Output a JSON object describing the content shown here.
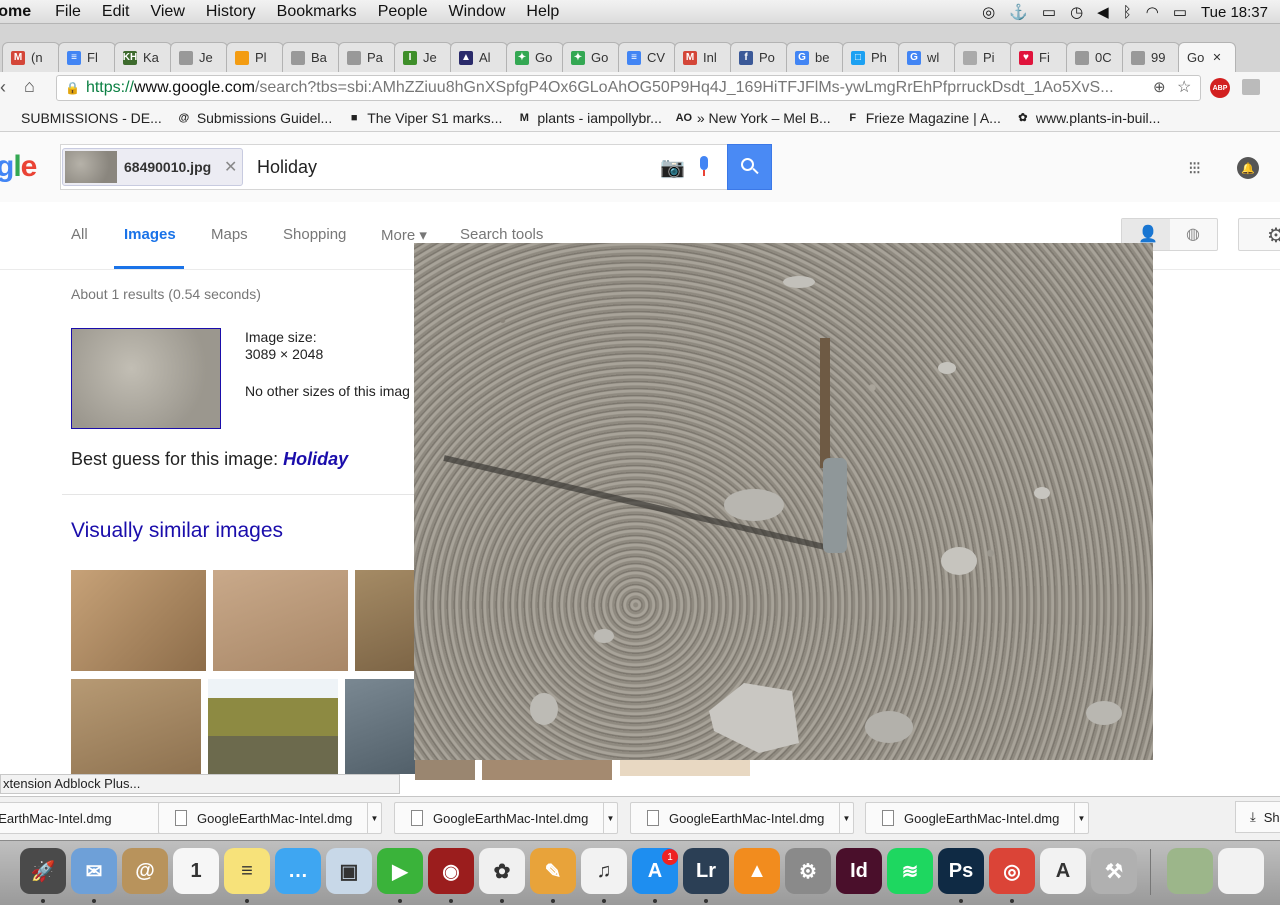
{
  "menubar": {
    "app": "rome",
    "items": [
      "File",
      "Edit",
      "View",
      "History",
      "Bookmarks",
      "People",
      "Window",
      "Help"
    ],
    "clock": "Tue 18:37"
  },
  "tabs": [
    {
      "label": "(n",
      "icon": "gmail-icon",
      "color": "#d44638",
      "glyph": "M"
    },
    {
      "label": "Fl",
      "icon": "docs-icon",
      "color": "#4285f4",
      "glyph": "≡"
    },
    {
      "label": "Ka",
      "icon": "kh-icon",
      "color": "#3e6b2e",
      "glyph": "KH"
    },
    {
      "label": "Je",
      "icon": "page-icon",
      "color": "#999",
      "glyph": ""
    },
    {
      "label": "Pl",
      "icon": "orange-shield-icon",
      "color": "#f39c12",
      "glyph": ""
    },
    {
      "label": "Ba",
      "icon": "page-icon",
      "color": "#999",
      "glyph": ""
    },
    {
      "label": "Pa",
      "icon": "page-icon",
      "color": "#999",
      "glyph": ""
    },
    {
      "label": "Je",
      "icon": "green-circle-icon",
      "color": "#3f8f2a",
      "glyph": "I"
    },
    {
      "label": "Al",
      "icon": "triangle-icon",
      "color": "#2a2a6a",
      "glyph": "▲"
    },
    {
      "label": "Go",
      "icon": "google-maps-icon",
      "color": "#34a853",
      "glyph": "✦"
    },
    {
      "label": "Go",
      "icon": "google-maps-icon",
      "color": "#34a853",
      "glyph": "✦"
    },
    {
      "label": "CV",
      "icon": "docs-icon",
      "color": "#4285f4",
      "glyph": "≡"
    },
    {
      "label": "Inl",
      "icon": "gmail-icon",
      "color": "#d44638",
      "glyph": "M"
    },
    {
      "label": "Po",
      "icon": "facebook-icon",
      "color": "#3b5998",
      "glyph": "f"
    },
    {
      "label": "be",
      "icon": "google-icon",
      "color": "#4285f4",
      "glyph": "G"
    },
    {
      "label": "Ph",
      "icon": "blue-icon",
      "color": "#1da1f2",
      "glyph": "□"
    },
    {
      "label": "wl",
      "icon": "google-icon",
      "color": "#4285f4",
      "glyph": "G"
    },
    {
      "label": "Pi",
      "icon": "apple-icon",
      "color": "#aaa",
      "glyph": ""
    },
    {
      "label": "Fi",
      "icon": "heart-icon",
      "color": "#e0143c",
      "glyph": "♥"
    },
    {
      "label": "0C",
      "icon": "page-icon",
      "color": "#999",
      "glyph": ""
    },
    {
      "label": "99",
      "icon": "page-icon",
      "color": "#999",
      "glyph": ""
    },
    {
      "label": "Go",
      "icon": "none",
      "color": "#fff",
      "glyph": ""
    }
  ],
  "omnibox": {
    "scheme": "https://",
    "host": "www.google.com",
    "path": "/search?tbs=sbi:AMhZZiuu8hGnXSpfgP4Ox6GLoAhOG50P9Hq4J_169HiTFJFlMs-ywLmgRrEhPfprruckDsdt_1Ao5XvS..."
  },
  "bookmarks": [
    {
      "label": "SUBMISSIONS - DE...",
      "icon": "page-icon",
      "glyph": ""
    },
    {
      "label": "Submissions Guidel...",
      "icon": "swirl-icon",
      "glyph": "@"
    },
    {
      "label": "The Viper S1 marks...",
      "icon": "flag-icon",
      "glyph": "■"
    },
    {
      "label": "plants - iampollybr...",
      "icon": "gmail-icon",
      "glyph": "M"
    },
    {
      "label": "» New York – Mel B...",
      "icon": "ao-icon",
      "glyph": "AO"
    },
    {
      "label": "Frieze Magazine | A...",
      "icon": "frieze-icon",
      "glyph": "F"
    },
    {
      "label": "www.plants-in-buil...",
      "icon": "leaf-icon",
      "glyph": "✿"
    }
  ],
  "search": {
    "logo": "gle",
    "chip_filename": "68490010.jpg",
    "query": "Holiday"
  },
  "nav_tabs": [
    "All",
    "Images",
    "Maps",
    "Shopping",
    "More ▾",
    "Search tools"
  ],
  "results": {
    "stats": "About 1 results (0.54 seconds)",
    "image_size_label": "Image size:",
    "image_size_value": "3089 × 2048",
    "no_other_sizes": "No other sizes of this imag",
    "best_guess_prefix": "Best guess for this image: ",
    "best_guess_term": "Holiday",
    "similar_heading": "Visually similar images"
  },
  "status_text": "xtension Adblock Plus...",
  "downloads": [
    "eEarthMac-Intel.dmg",
    "GoogleEarthMac-Intel.dmg",
    "GoogleEarthMac-Intel.dmg",
    "GoogleEarthMac-Intel.dmg",
    "GoogleEarthMac-Intel.dmg"
  ],
  "downloads_show_all": "Sh",
  "dock": [
    {
      "name": "launchpad-icon",
      "color": "#4a4a4a",
      "glyph": "🚀"
    },
    {
      "name": "mail-stamp-icon",
      "color": "#6ea0d8",
      "glyph": "✉"
    },
    {
      "name": "contacts-icon",
      "color": "#b8935c",
      "glyph": "@"
    },
    {
      "name": "calendar-icon",
      "color": "#f6f6f6",
      "glyph": "1"
    },
    {
      "name": "notes-icon",
      "color": "#f7e27a",
      "glyph": "≡"
    },
    {
      "name": "messages-icon",
      "color": "#3ea6f2",
      "glyph": "…"
    },
    {
      "name": "preview-icon",
      "color": "#c8d8e8",
      "glyph": "▣"
    },
    {
      "name": "facetime-icon",
      "color": "#3ab33a",
      "glyph": "▶"
    },
    {
      "name": "photo-booth-icon",
      "color": "#9b1d1d",
      "glyph": "◉"
    },
    {
      "name": "photos-icon",
      "color": "#f0f0f0",
      "glyph": "✿"
    },
    {
      "name": "pages-icon",
      "color": "#e8a33a",
      "glyph": "✎"
    },
    {
      "name": "itunes-icon",
      "color": "#f2f2f2",
      "glyph": "♫"
    },
    {
      "name": "app-store-icon",
      "color": "#1e8ef0",
      "glyph": "A"
    },
    {
      "name": "lightroom-icon",
      "color": "#2b3f55",
      "glyph": "Lr"
    },
    {
      "name": "vlc-icon",
      "color": "#f28c1e",
      "glyph": "▲"
    },
    {
      "name": "system-preferences-icon",
      "color": "#8a8a8a",
      "glyph": "⚙"
    },
    {
      "name": "indesign-icon",
      "color": "#4a0f2b",
      "glyph": "Id"
    },
    {
      "name": "spotify-icon",
      "color": "#1ed760",
      "glyph": "≋"
    },
    {
      "name": "photoshop-icon",
      "color": "#0f2a44",
      "glyph": "Ps"
    },
    {
      "name": "chrome-icon",
      "color": "#db4437",
      "glyph": "◎"
    },
    {
      "name": "acrobat-icon",
      "color": "#f2f2f2",
      "glyph": "A"
    },
    {
      "name": "script-utility-icon",
      "color": "#b0b0b0",
      "glyph": "⚒"
    },
    {
      "name": "thumbnail-icon",
      "color": "#9cb68a",
      "glyph": ""
    },
    {
      "name": "document-icon",
      "color": "#f2f2f2",
      "glyph": ""
    }
  ],
  "app_store_badge": "1",
  "colors": {
    "accent": "#4a8af4",
    "link": "#1a0dab",
    "active_tab": "#1a73e8"
  }
}
